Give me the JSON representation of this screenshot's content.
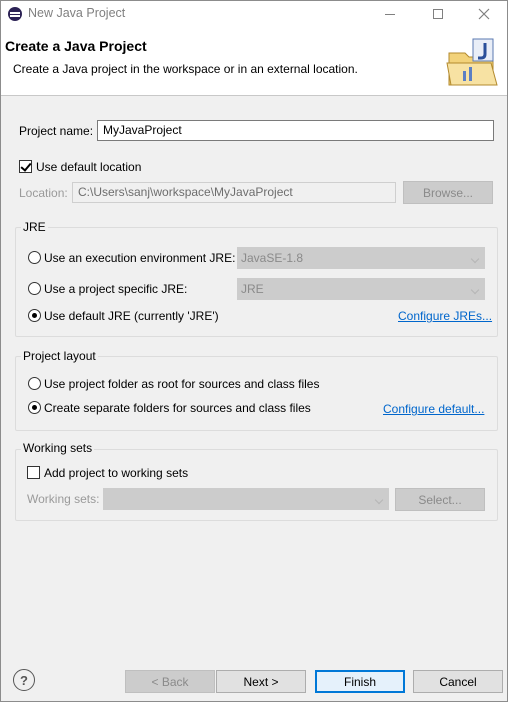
{
  "window": {
    "title": "New Java Project"
  },
  "banner": {
    "heading": "Create a Java Project",
    "description": "Create a Java project in the workspace or in an external location."
  },
  "project": {
    "name_label": "Project name:",
    "name_value": "MyJavaProject",
    "use_default_location_label": "Use default location",
    "use_default_location_checked": true,
    "location_label": "Location:",
    "location_value": "C:\\Users\\sanj\\workspace\\MyJavaProject",
    "browse_label": "Browse..."
  },
  "jre": {
    "group_title": "JRE",
    "options": [
      {
        "label": "Use an execution environment JRE:",
        "selected": false,
        "combo": "JavaSE-1.8"
      },
      {
        "label": "Use a project specific JRE:",
        "selected": false,
        "combo": "JRE"
      },
      {
        "label": "Use default JRE (currently 'JRE')",
        "selected": true
      }
    ],
    "configure_link": "Configure JREs..."
  },
  "layout": {
    "group_title": "Project layout",
    "options": [
      {
        "label": "Use project folder as root for sources and class files",
        "selected": false
      },
      {
        "label": "Create separate folders for sources and class files",
        "selected": true
      }
    ],
    "configure_link": "Configure default..."
  },
  "working_sets": {
    "group_title": "Working sets",
    "add_label": "Add project to working sets",
    "add_checked": false,
    "sets_label": "Working sets:",
    "select_label": "Select..."
  },
  "footer": {
    "help_glyph": "?",
    "back_label": "< Back",
    "next_label": "Next >",
    "finish_label": "Finish",
    "cancel_label": "Cancel"
  },
  "colors": {
    "accent": "#0078d7",
    "link": "#0066cc"
  }
}
